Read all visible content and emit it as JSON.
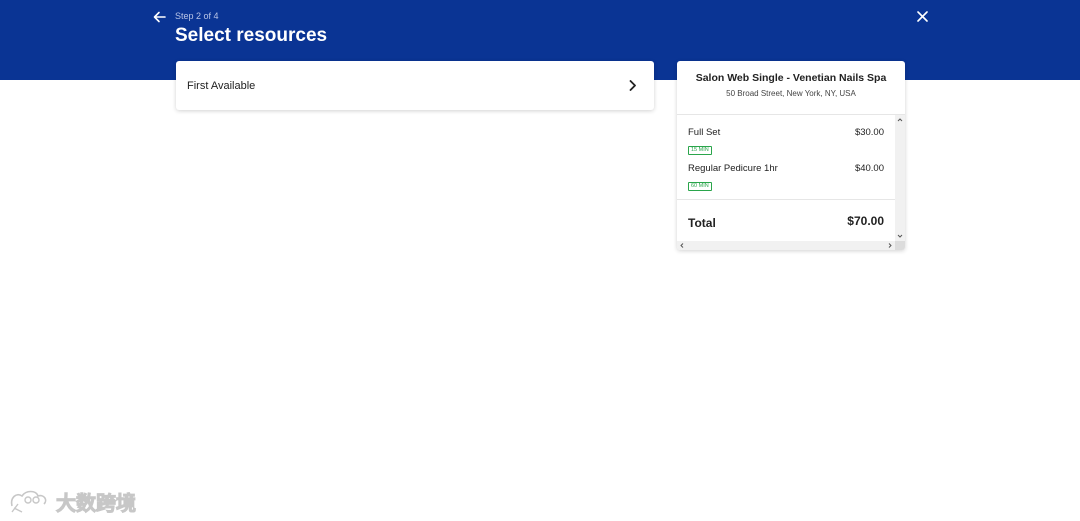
{
  "header": {
    "step_label": "Step 2 of 4",
    "title": "Select resources",
    "back_icon": "arrow-left-icon",
    "close_icon": "close-icon",
    "background_color": "#0a3494"
  },
  "resources": {
    "items": [
      {
        "label": "First Available",
        "icon": "chevron-right-icon"
      }
    ]
  },
  "summary": {
    "salon_name": "Salon Web Single - Venetian Nails Spa",
    "address": "50 Broad Street, New York, NY, USA",
    "services": [
      {
        "name": "Full Set",
        "price": "$30.00",
        "duration": "15 MIN"
      },
      {
        "name": "Regular Pedicure 1hr",
        "price": "$40.00",
        "duration": "60 MIN"
      }
    ],
    "total_label": "Total",
    "total_value": "$70.00",
    "badge_color": "#2aa54b"
  },
  "watermark": {
    "text": "大数跨境"
  }
}
